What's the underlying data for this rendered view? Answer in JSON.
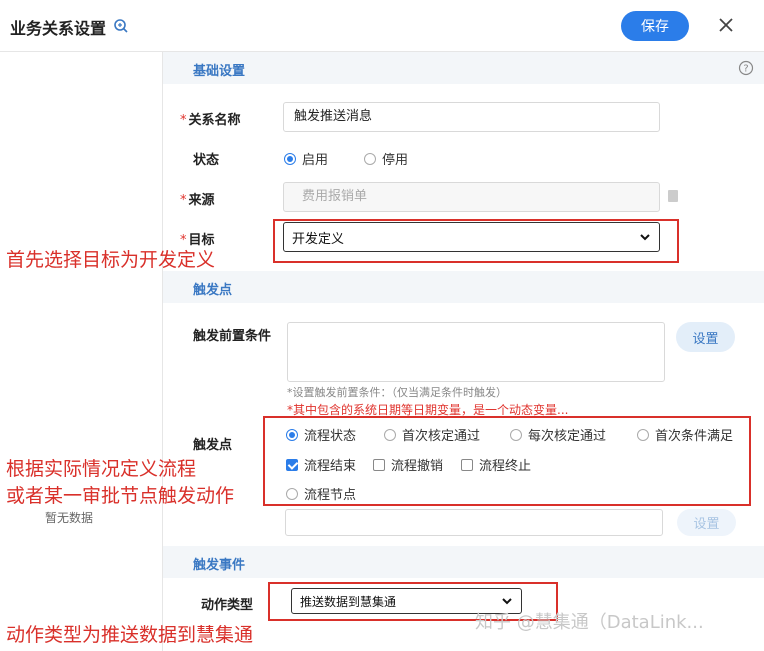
{
  "header": {
    "title": "业务关系设置",
    "save_label": "保存"
  },
  "sidebar": {
    "empty_text": "暂无数据"
  },
  "sections": {
    "basic": "基础设置",
    "trigger_point": "触发点",
    "trigger_event": "触发事件"
  },
  "form": {
    "relation_name_label": "关系名称",
    "relation_name_value": "触发推送消息",
    "status_label": "状态",
    "status_options": [
      "启用",
      "停用"
    ],
    "source_label": "来源",
    "source_value": "费用报销单",
    "target_label": "目标",
    "target_value": "开发定义",
    "precondition_label": "触发前置条件",
    "set_label": "设置",
    "hint_1": "*设置触发前置条件：（仅当满足条件时触发）",
    "hint_2": "*其中包含的系统日期等日期变量，是一个动态变量...",
    "trigger_label": "触发点",
    "trigger_radios": [
      "流程状态",
      "首次核定通过",
      "每次核定通过",
      "首次条件满足"
    ],
    "trigger_checks": [
      "流程结束",
      "流程撤销",
      "流程终止"
    ],
    "trigger_node": "流程节点",
    "action_type_label": "动作类型",
    "action_type_value": "推送数据到慧集通"
  },
  "annotations": {
    "a1": "首先选择目标为开发定义",
    "a2_line1": "根据实际情况定义流程",
    "a2_line2": "或者某一审批节点触发动作",
    "a3": "动作类型为推送数据到慧集通"
  },
  "watermark": "知乎 @慧集通（DataLink...",
  "colors": {
    "accent": "#2b7de9",
    "annotation_red": "#d9302a",
    "section_text": "#3a78c3"
  }
}
